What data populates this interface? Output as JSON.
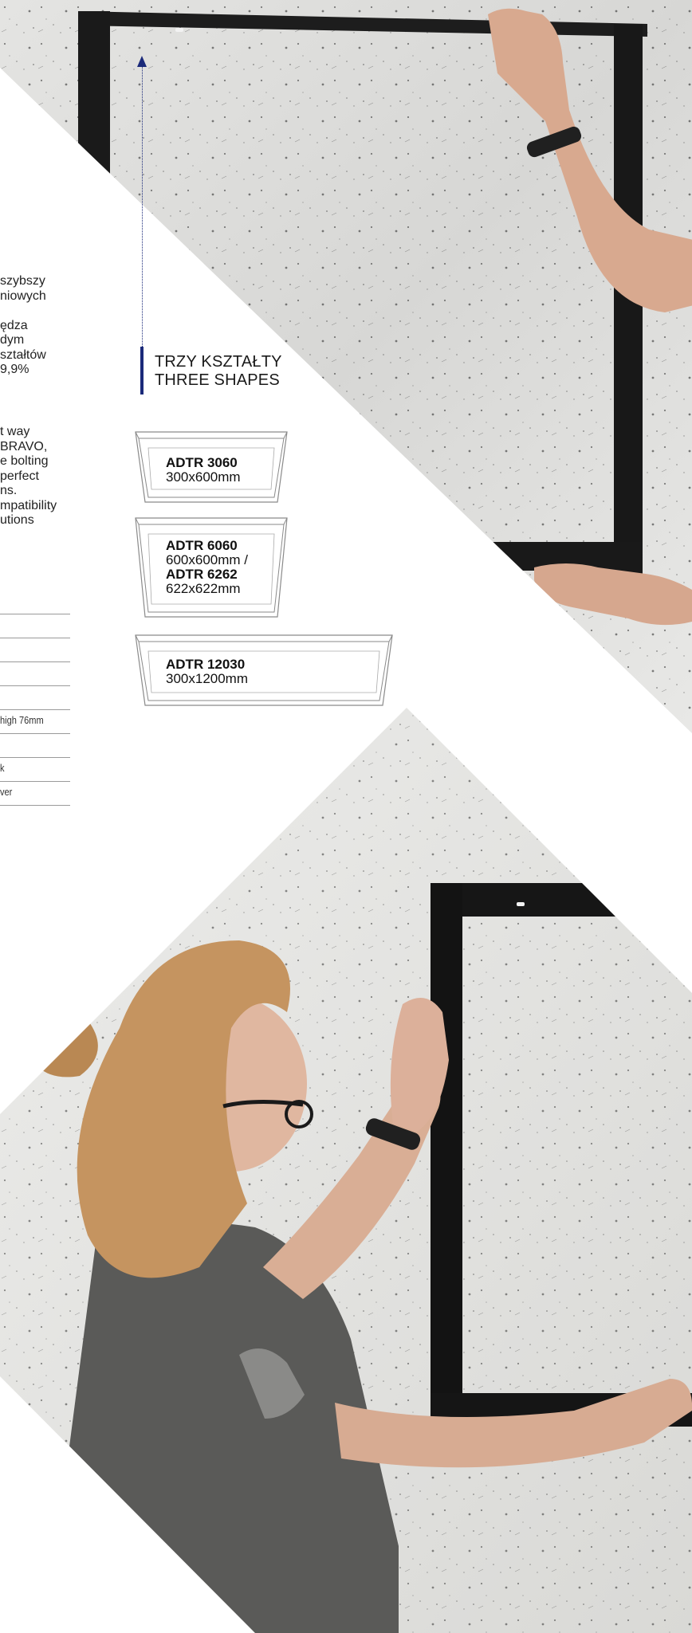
{
  "intro_pl": {
    "lines": [
      "szybszy",
      "niowych",
      "",
      "ędza",
      "dym",
      "ształtów",
      "9,9%"
    ]
  },
  "intro_en": {
    "lines": [
      "t way",
      "BRAVO,",
      "e bolting",
      "perfect",
      "ns.",
      "mpatibility",
      "utions"
    ]
  },
  "spec": {
    "rows": [
      "",
      "",
      "",
      "",
      "",
      "high 76mm",
      "",
      "k",
      "ver"
    ]
  },
  "shapes_heading": {
    "line_pl": "TRZY KSZTAŁTY",
    "line_en": "THREE SHAPES"
  },
  "shapes": [
    {
      "code": "ADTR 3060",
      "size": "300x600mm"
    },
    {
      "code": "ADTR 6060",
      "size": "600x600mm /",
      "code2": "ADTR 6262",
      "size2": "622x622mm"
    },
    {
      "code": "ADTR 12030",
      "size": "300x1200mm"
    }
  ],
  "colors": {
    "accent": "#1b2a7a",
    "frame": "#161616"
  }
}
